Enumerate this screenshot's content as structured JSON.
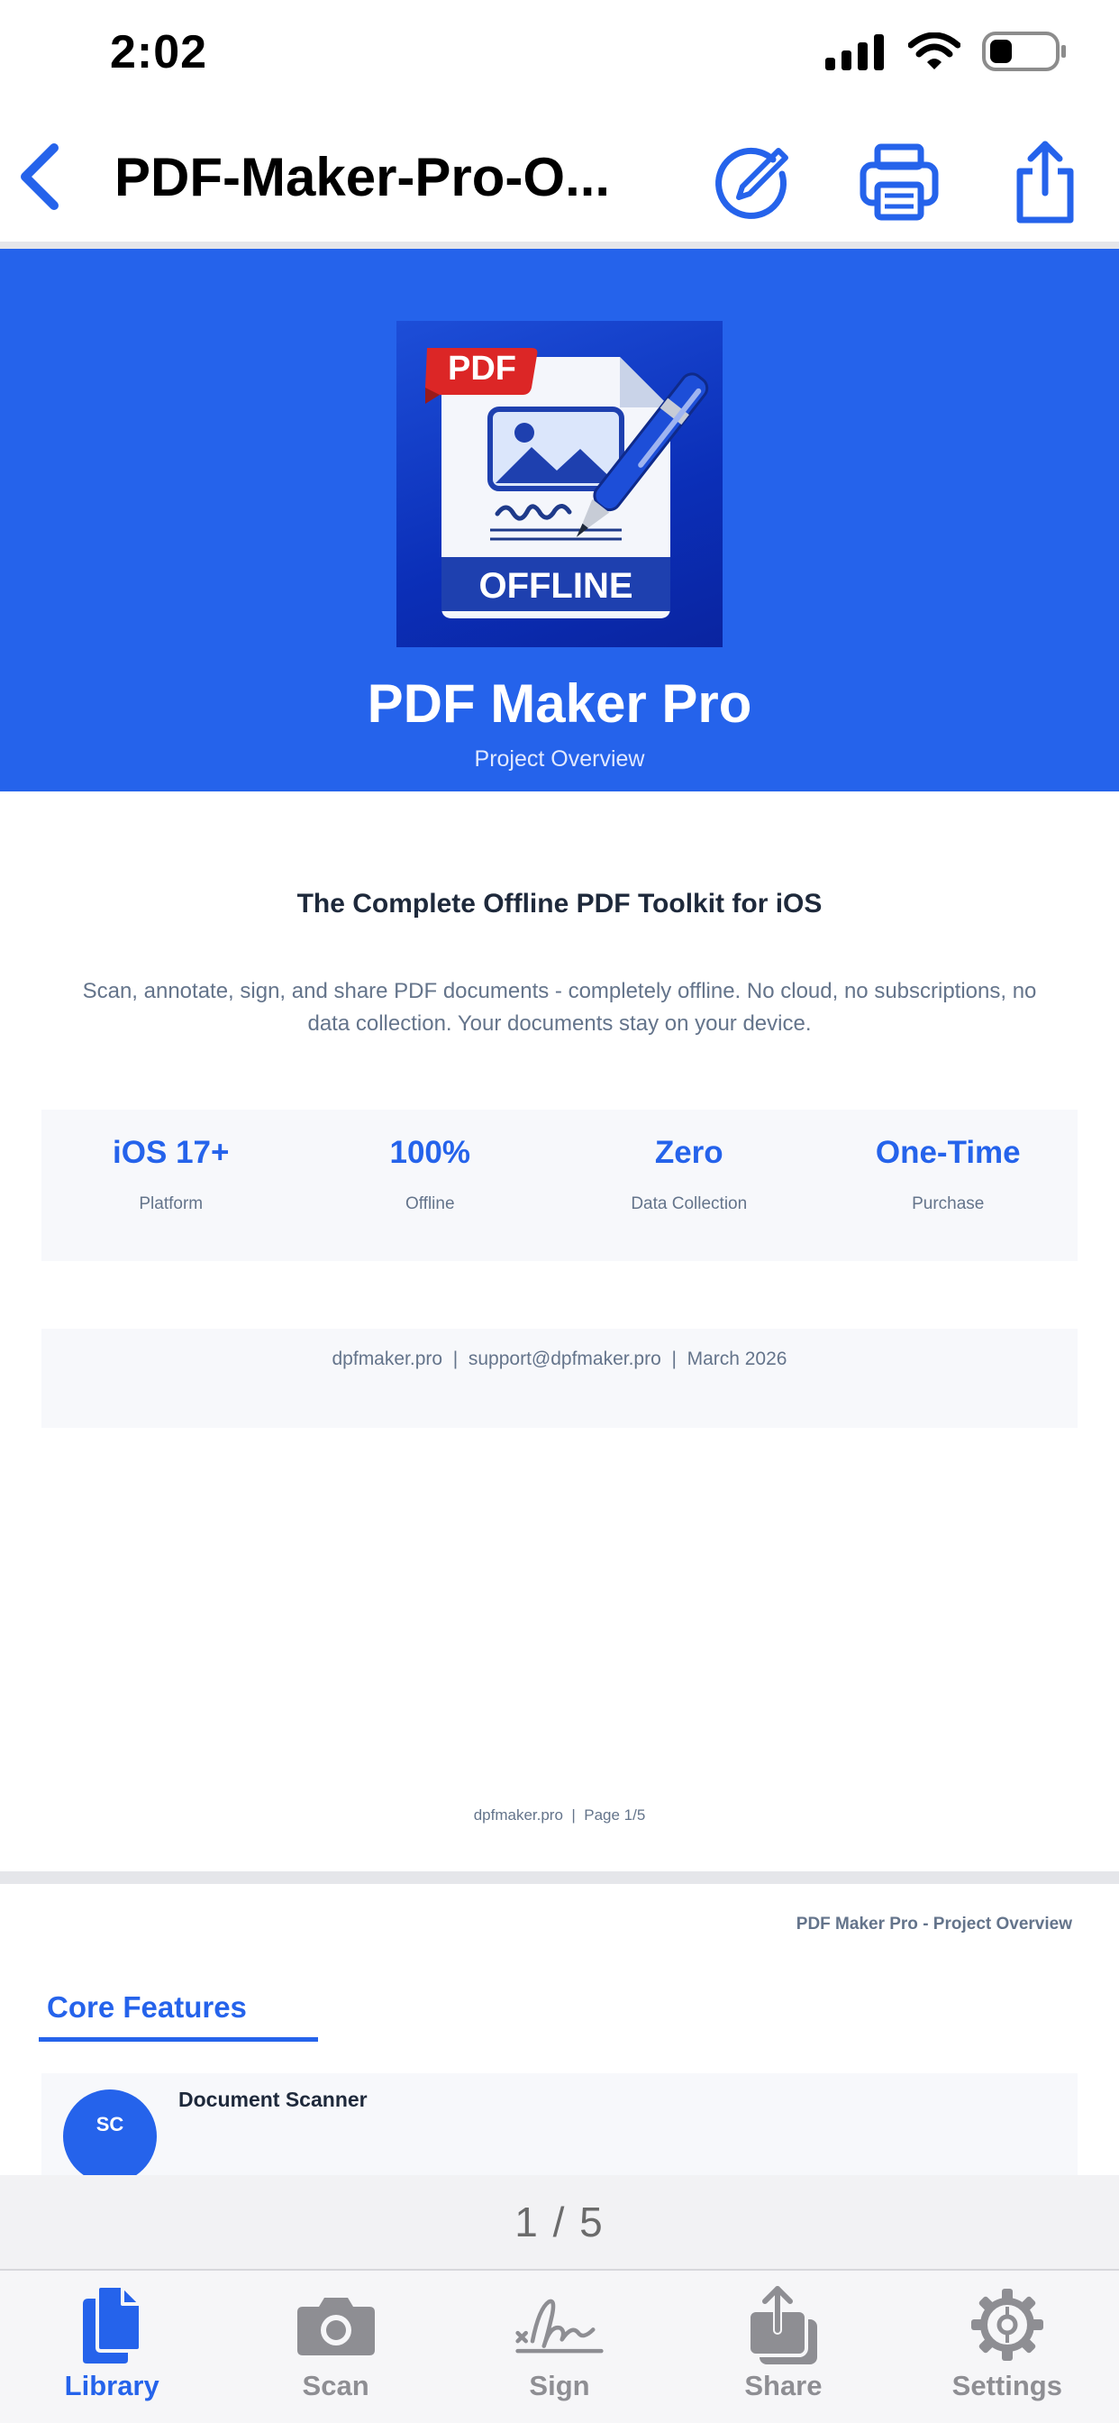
{
  "status_bar": {
    "time": "2:02"
  },
  "nav": {
    "title": "PDF-Maker-Pro-O..."
  },
  "page1": {
    "hero": {
      "logo_badge": "PDF",
      "logo_label": "OFFLINE",
      "title": "PDF Maker Pro",
      "subtitle": "Project Overview"
    },
    "tagline": "The Complete Offline PDF Toolkit for iOS",
    "description": "Scan, annotate, sign, and share PDF documents - completely offline. No cloud, no subscriptions, no data collection. Your documents stay on your device.",
    "stats": [
      {
        "value": "iOS 17+",
        "label": "Platform"
      },
      {
        "value": "100%",
        "label": "Offline"
      },
      {
        "value": "Zero",
        "label": "Data Collection"
      },
      {
        "value": "One-Time",
        "label": "Purchase"
      }
    ],
    "contact": "dpfmaker.pro  |  support@dpfmaker.pro  |  March 2026",
    "footer": "dpfmaker.pro  |  Page 1/5"
  },
  "page2": {
    "header": "PDF Maker Pro - Project Overview",
    "section_title": "Core Features",
    "features": [
      {
        "initials": "SC",
        "title": "Document Scanner"
      }
    ]
  },
  "page_indicator": "1 / 5",
  "tabs": [
    {
      "label": "Library",
      "icon": "library-icon",
      "active": true
    },
    {
      "label": "Scan",
      "icon": "camera-icon",
      "active": false
    },
    {
      "label": "Sign",
      "icon": "signature-icon",
      "active": false
    },
    {
      "label": "Share",
      "icon": "share-icon",
      "active": false
    },
    {
      "label": "Settings",
      "icon": "gear-icon",
      "active": false
    }
  ],
  "colors": {
    "accent": "#2563eb",
    "hero_bg": "#2563eb",
    "muted_text": "#64748b",
    "inactive_tab": "#8e8e93"
  }
}
